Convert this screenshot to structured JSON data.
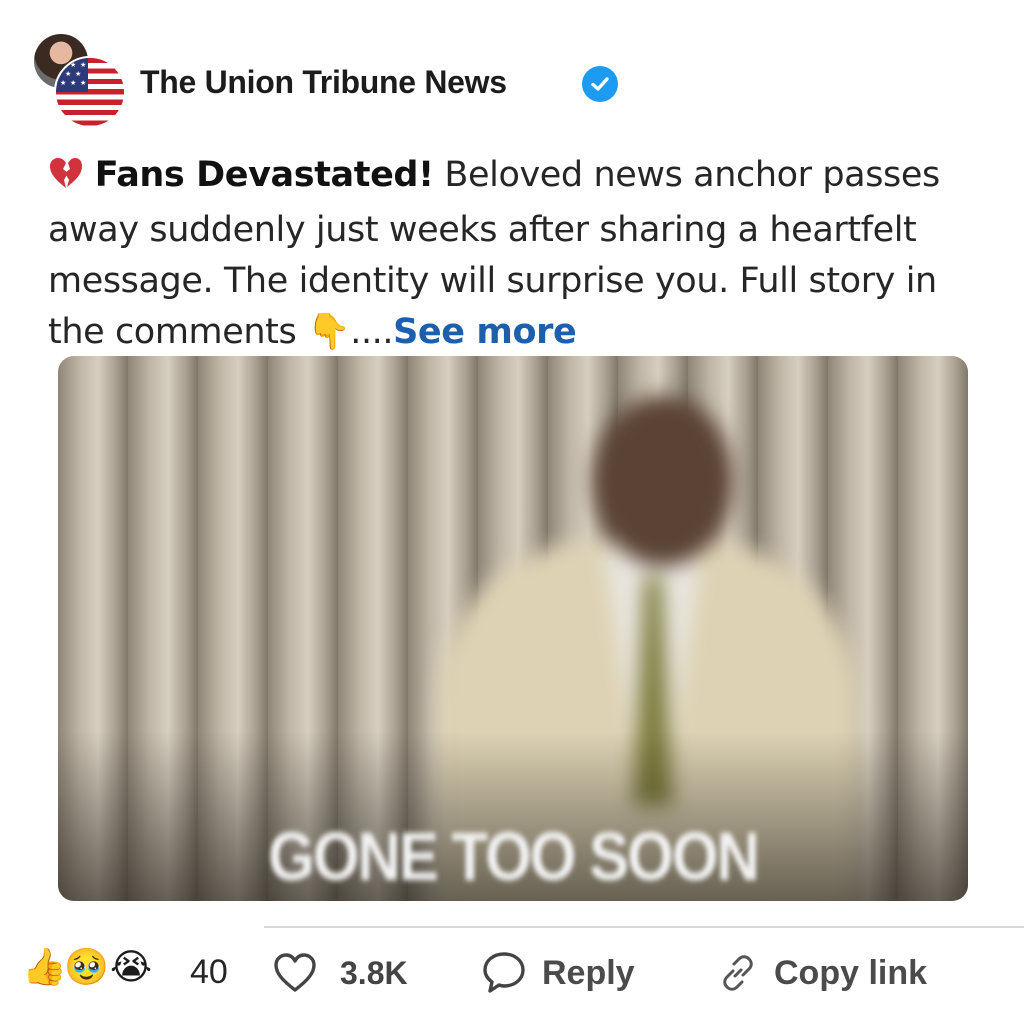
{
  "header": {
    "page_name": "The Union Tribune News",
    "avatar_icon": "profile-photo",
    "badge_icon": "us-flag-icon",
    "verified_icon": "verified-check-icon",
    "verified_color": "#1d9bf0"
  },
  "post": {
    "emoji_icon": "broken-heart-icon",
    "headline": "Fans Devastated!",
    "body": "Beloved news anchor passes away suddenly just weeks after sharing a heartfelt message. The identity will surprise you. Full story in the comments",
    "pointing_icon": "backhand-index-pointing-down-icon",
    "ellipsis": "....",
    "see_more": "See more",
    "see_more_color": "#1b5fae"
  },
  "media": {
    "overlay_text": "GONE TOO SOON"
  },
  "footer": {
    "reaction_icons": [
      "thumbs-up-icon",
      "face-holding-back-tears-icon",
      "loudly-crying-face-icon"
    ],
    "reaction_count": "40",
    "like_icon": "heart-outline-icon",
    "like_count": "3.8K",
    "reply_icon": "speech-bubble-icon",
    "reply_label": "Reply",
    "copy_icon": "link-icon",
    "copy_label": "Copy link"
  }
}
